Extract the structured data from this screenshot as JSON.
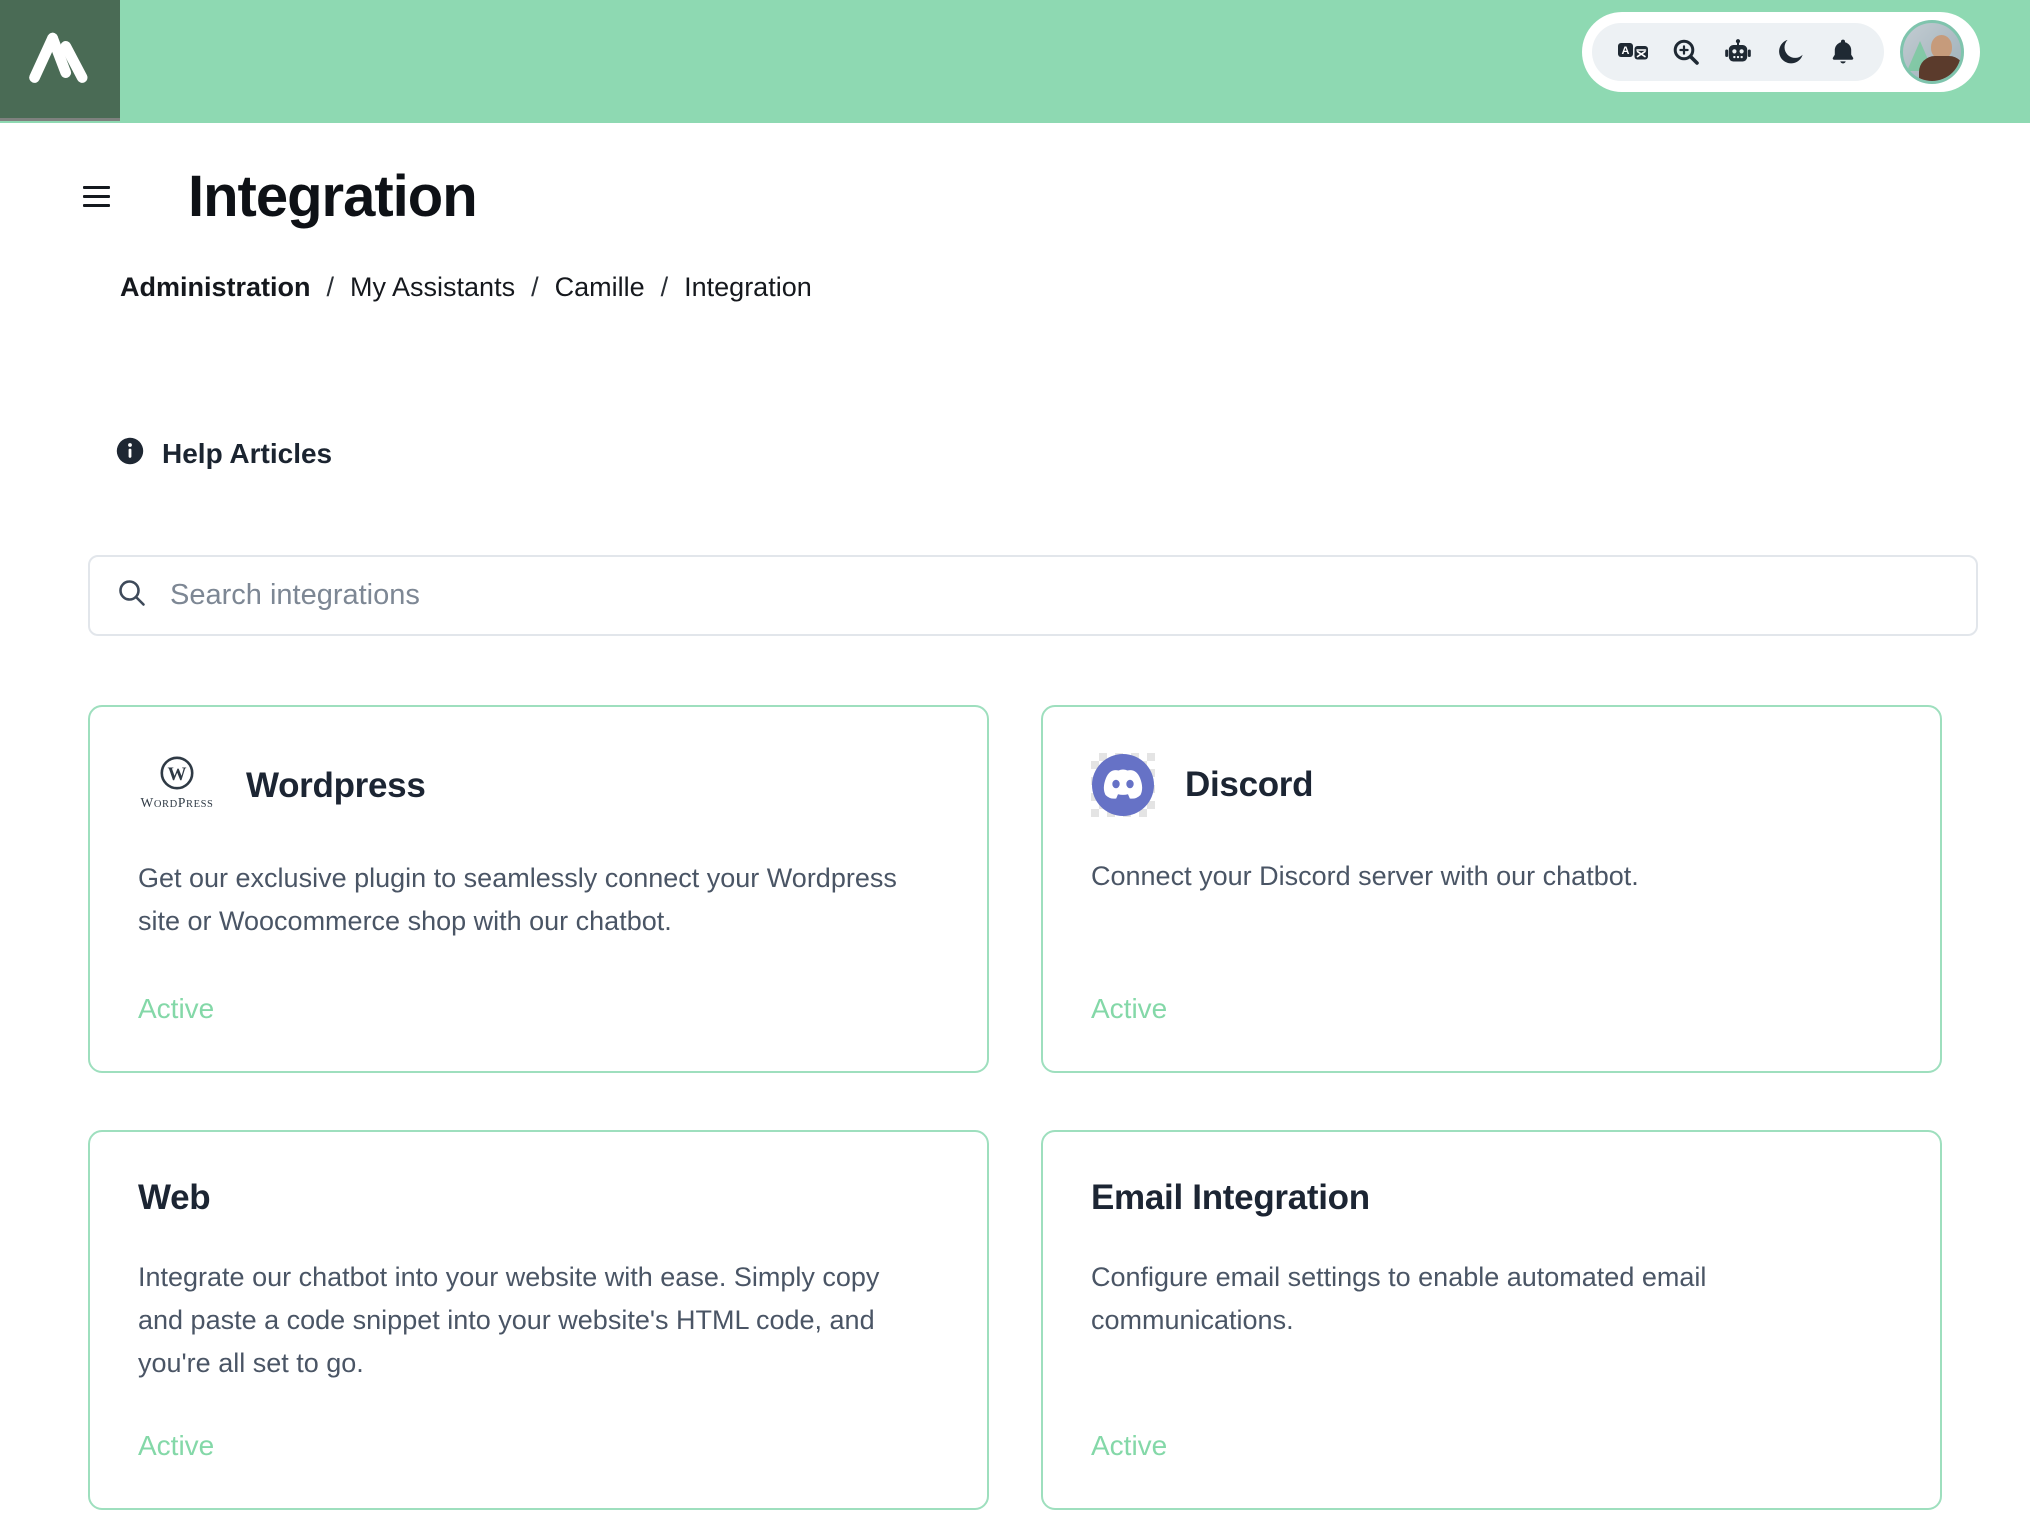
{
  "colors": {
    "header_green": "#8ed9b2",
    "logo_green": "#4a6b55",
    "active_green": "#84d8a8",
    "card_border_green": "#9edfbe",
    "icon_dark": "#1f2933",
    "discord_purple": "#6672c6",
    "text_dark": "#1c2533",
    "text_body": "#4a5565"
  },
  "header": {
    "logo_icon": "mountain-logo",
    "toolbar_icons": [
      {
        "name": "translate-icon"
      },
      {
        "name": "zoom-in-icon"
      },
      {
        "name": "robot-icon"
      },
      {
        "name": "dark-mode-moon-icon"
      },
      {
        "name": "notifications-bell-icon"
      }
    ],
    "avatar": "user-avatar"
  },
  "page": {
    "title": "Integration",
    "breadcrumb": {
      "separator": "/",
      "items": [
        "Administration",
        "My Assistants",
        "Camille",
        "Integration"
      ]
    },
    "help_label": "Help Articles",
    "search": {
      "placeholder": "Search integrations",
      "value": ""
    }
  },
  "cards": [
    {
      "icon": "wordpress-logo",
      "title": "Wordpress",
      "description": "Get our exclusive plugin to seamlessly connect your Wordpress site or Woocommerce shop with our chatbot.",
      "status": "Active"
    },
    {
      "icon": "discord-logo",
      "title": "Discord",
      "description": "Connect your Discord server with our chatbot.",
      "status": "Active"
    },
    {
      "icon": null,
      "title": "Web",
      "description": "Integrate our chatbot into your website with ease. Simply copy and paste a code snippet into your website's HTML code, and you're all set to go.",
      "status": "Active"
    },
    {
      "icon": null,
      "title": "Email Integration",
      "description": "Configure email settings to enable automated email communications.",
      "status": "Active"
    }
  ]
}
